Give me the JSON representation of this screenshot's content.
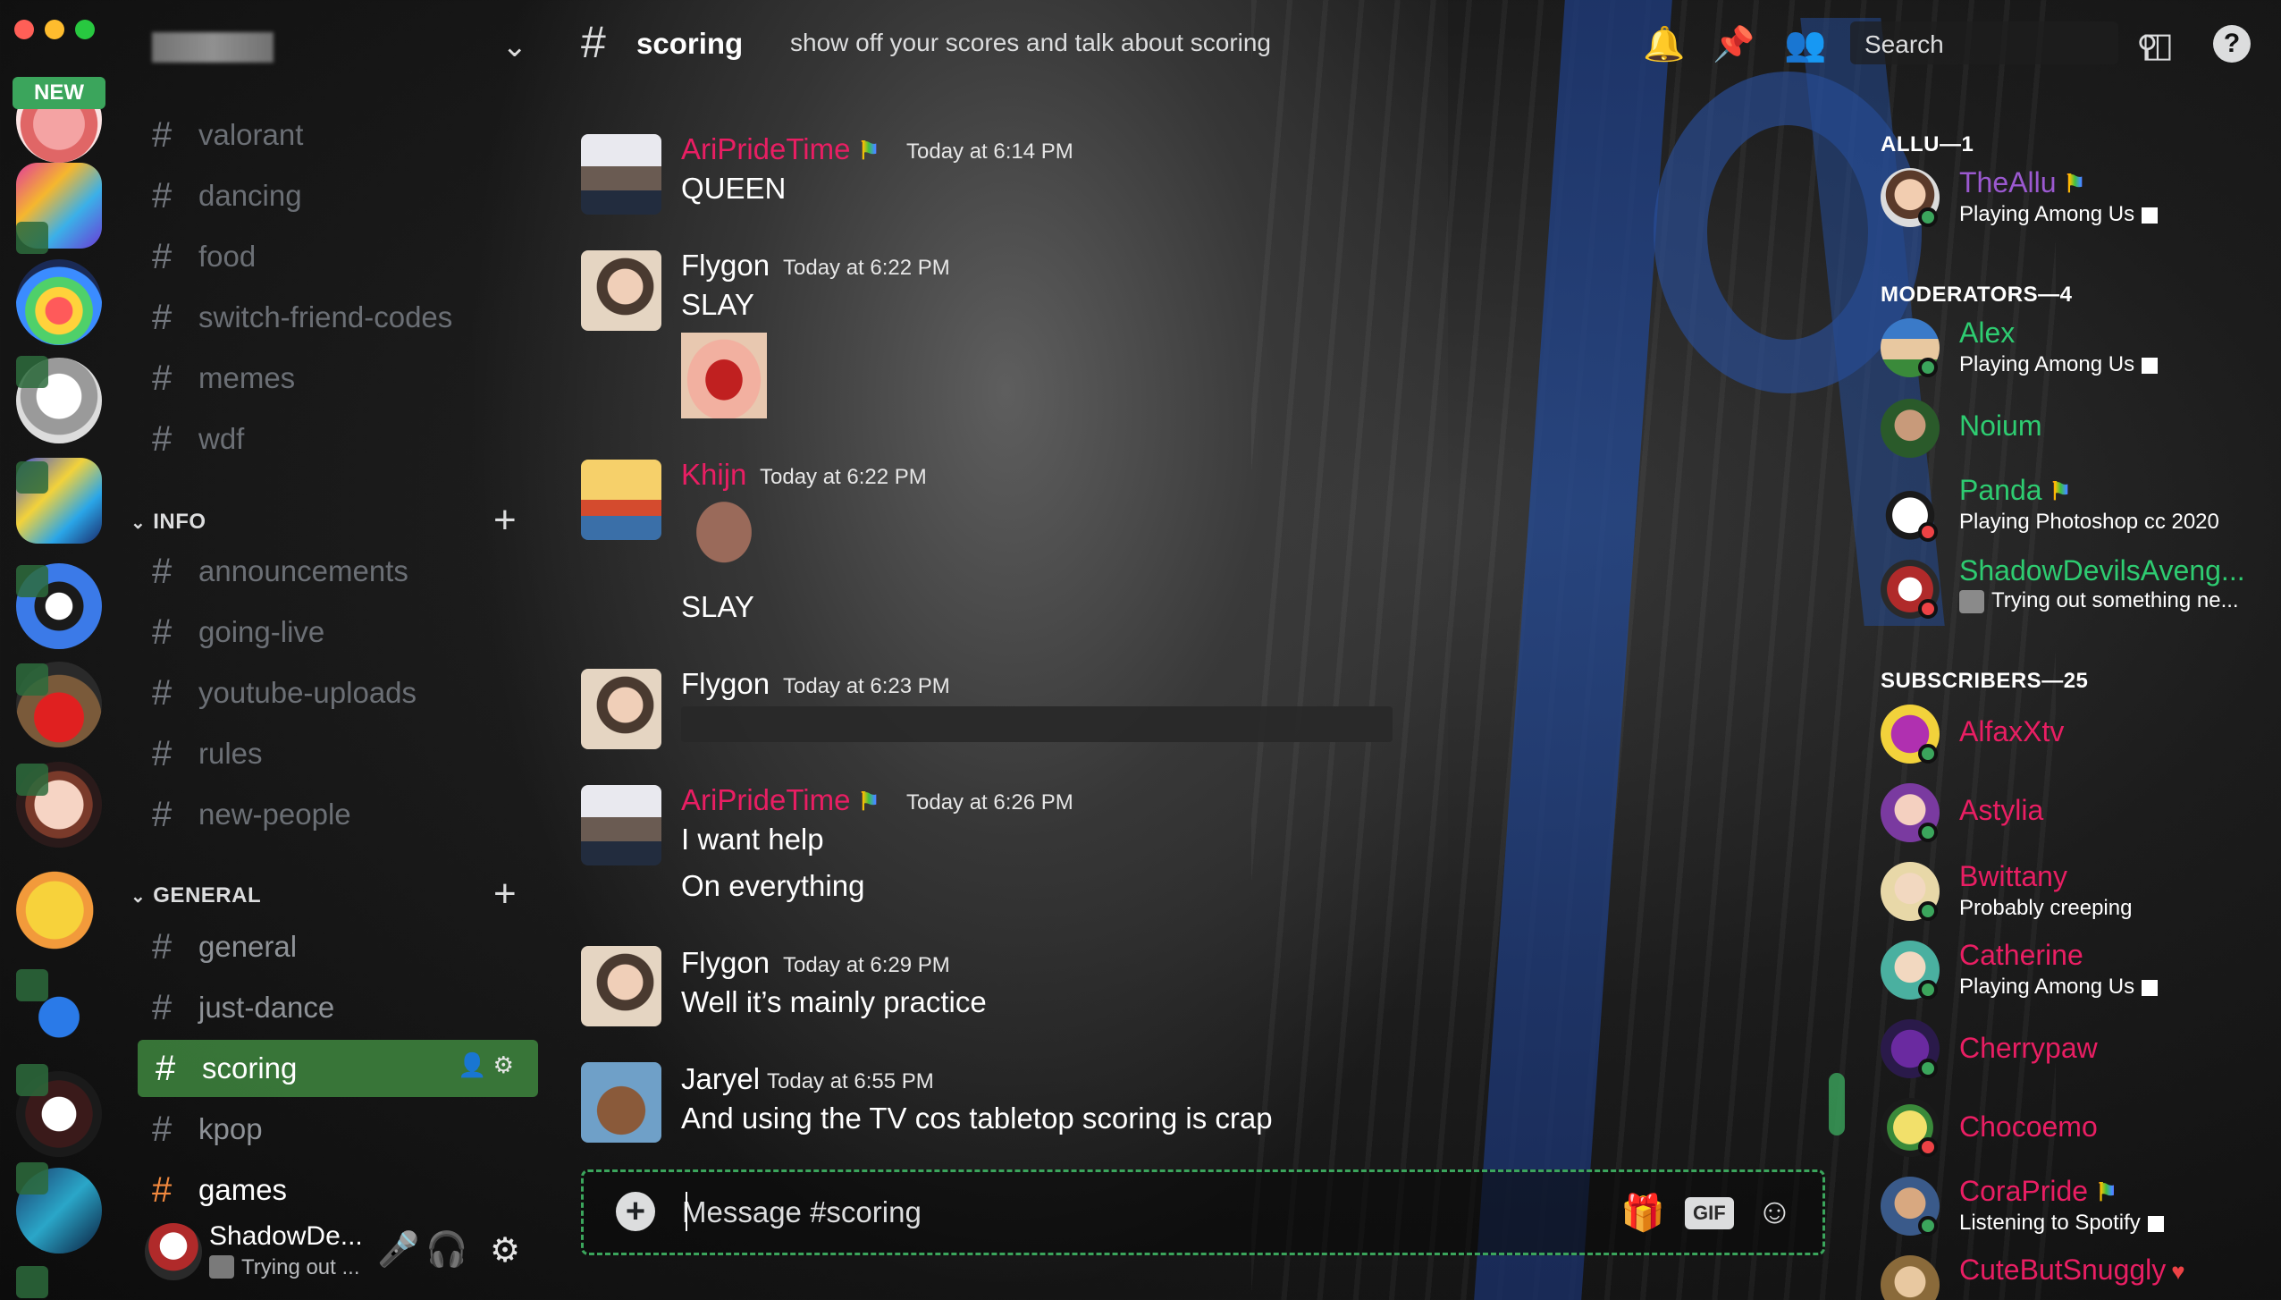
{
  "window": {
    "controls": [
      "close",
      "minimize",
      "zoom"
    ]
  },
  "servers": {
    "new_badge": "NEW"
  },
  "sidebar": {
    "channels_top": [
      {
        "name": "valorant"
      },
      {
        "name": "dancing"
      },
      {
        "name": "food"
      },
      {
        "name": "switch-friend-codes"
      },
      {
        "name": "memes"
      },
      {
        "name": "wdf"
      }
    ],
    "category_info": "INFO",
    "channels_info": [
      {
        "name": "announcements"
      },
      {
        "name": "going-live"
      },
      {
        "name": "youtube-uploads"
      },
      {
        "name": "rules"
      },
      {
        "name": "new-people"
      }
    ],
    "category_general": "GENERAL",
    "channels_general": [
      {
        "name": "general"
      },
      {
        "name": "just-dance"
      },
      {
        "name": "scoring"
      },
      {
        "name": "kpop"
      },
      {
        "name": "games"
      }
    ],
    "hash": "#"
  },
  "user_panel": {
    "name": "ShadowDe...",
    "status": "Trying out ..."
  },
  "header": {
    "channel": "scoring",
    "topic": "show off your scores and talk about scoring",
    "search_placeholder": "Search"
  },
  "messages": [
    {
      "author": "AriPrideTime",
      "time": "Today at 6:14 PM",
      "lines": [
        "QUEEN"
      ]
    },
    {
      "author": "Flygon",
      "time": "Today at 6:22 PM",
      "lines": [
        "SLAY"
      ]
    },
    {
      "author": "Khijn",
      "time": "Today at 6:22 PM",
      "lines": [
        "SLAY"
      ]
    },
    {
      "author": "Flygon",
      "time": "Today at 6:23 PM",
      "lines": []
    },
    {
      "author": "AriPrideTime",
      "time": "Today at 6:26 PM",
      "lines": [
        "I want help",
        "On everything"
      ]
    },
    {
      "author": "Flygon",
      "time": "Today at 6:29 PM",
      "lines": [
        "Well it’s mainly practice"
      ]
    },
    {
      "author": "Jaryel",
      "time": "Today at 6:55 PM",
      "lines": [
        "And using the TV cos tabletop scoring is crap"
      ]
    }
  ],
  "composer": {
    "placeholder": "Message #scoring",
    "gif_label": "GIF"
  },
  "members": {
    "groups": [
      {
        "label": "ALLU—1"
      },
      {
        "label": "MODERATORS—4"
      },
      {
        "label": "SUBSCRIBERS—25"
      }
    ],
    "list": [
      {
        "name": "TheAllu",
        "activity": "Playing Among Us",
        "color": "#9b59d0"
      },
      {
        "name": "Alex",
        "activity": "Playing Among Us",
        "color": "#2ecc71"
      },
      {
        "name": "Noium",
        "activity": "",
        "color": "#2ecc71"
      },
      {
        "name": "Panda",
        "activity": "Playing Photoshop cc 2020",
        "color": "#2ecc71"
      },
      {
        "name": "ShadowDevilsAveng...",
        "activity": "Trying out something ne...",
        "color": "#2ecc71"
      },
      {
        "name": "AlfaxXtv",
        "activity": "",
        "color": "#e91e63"
      },
      {
        "name": "Astylia",
        "activity": "",
        "color": "#e91e63"
      },
      {
        "name": "Bwittany",
        "activity": "Probably creeping",
        "color": "#e91e63"
      },
      {
        "name": "Catherine",
        "activity": "Playing Among Us",
        "color": "#e91e63"
      },
      {
        "name": "Cherrypaw",
        "activity": "",
        "color": "#e91e63"
      },
      {
        "name": "Chocoemo",
        "activity": "",
        "color": "#e91e63"
      },
      {
        "name": "CoraPride",
        "activity": "Listening to Spotify",
        "color": "#e91e63"
      },
      {
        "name": "CuteButSnuggly",
        "activity": "",
        "color": "#e91e63"
      }
    ]
  },
  "colors": {
    "accent_green": "#3ba55c",
    "name_pink": "#e91e63",
    "name_purple": "#9b59d0",
    "name_green": "#2ecc71",
    "online": "#3ba55c",
    "dnd": "#ed4245"
  }
}
